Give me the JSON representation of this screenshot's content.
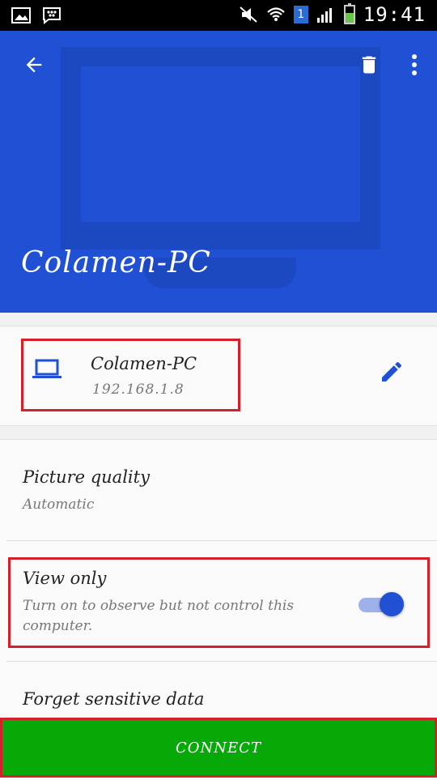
{
  "status_bar": {
    "time": "19:41",
    "sim_badge": "1",
    "icons": [
      "gallery-icon",
      "bbm-icon",
      "mute-icon",
      "wifi-icon",
      "signal-icon",
      "battery-icon"
    ]
  },
  "header": {
    "title": "Colamen-PC",
    "background_color": "#2050d3",
    "icons": [
      "back-arrow-icon",
      "delete-icon",
      "more-vert-icon",
      "monitor-icon"
    ]
  },
  "device": {
    "name": "Colamen-PC",
    "ip": "192.168.1.8",
    "icons": [
      "laptop-icon",
      "edit-pencil-icon"
    ]
  },
  "settings": {
    "picture_quality": {
      "title": "Picture quality",
      "value": "Automatic"
    },
    "view_only": {
      "title": "View only",
      "description_line1": "Turn on to observe but not control this",
      "description_line2": "computer.",
      "enabled": true
    },
    "forget": {
      "title": "Forget sensitive data"
    }
  },
  "connect": {
    "label": "CONNECT",
    "color": "#07a908"
  },
  "colors": {
    "accent": "#2050d3",
    "highlight_box": "#d4202a"
  }
}
